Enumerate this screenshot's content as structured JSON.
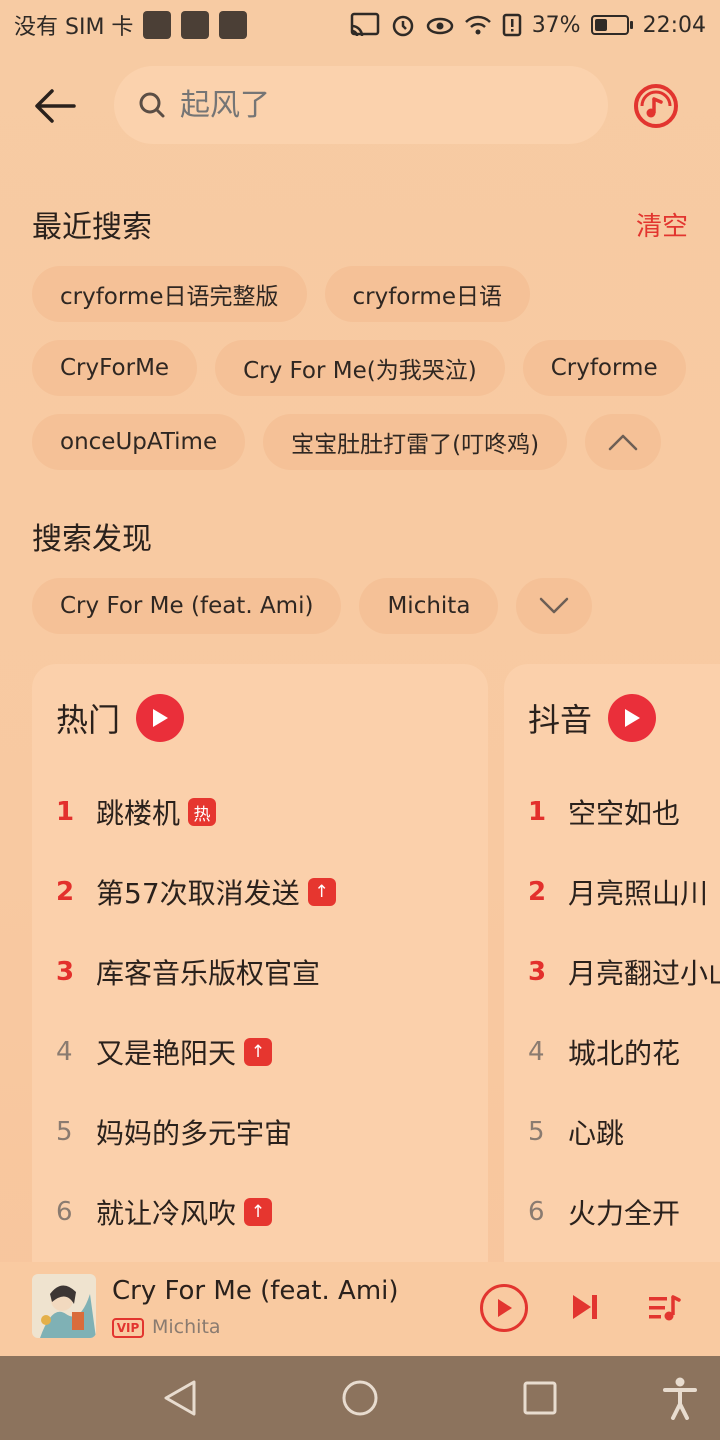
{
  "status_bar": {
    "carrier": "没有 SIM 卡",
    "battery": "37%",
    "time": "22:04"
  },
  "search": {
    "placeholder": "起风了"
  },
  "recent": {
    "title": "最近搜索",
    "clear_label": "清空",
    "chips": [
      [
        "cryforme日语完整版",
        "cryforme日语"
      ],
      [
        "CryForMe",
        "Cry For Me(为我哭泣)",
        "Cryforme"
      ],
      [
        "onceUpATime",
        "宝宝肚肚打雷了(叮咚鸡)"
      ]
    ]
  },
  "discover": {
    "title": "搜索发现",
    "chips": [
      "Cry For Me (feat. Ami)",
      "Michita"
    ]
  },
  "hot_chart": {
    "title": "热门",
    "items": [
      {
        "rank": "1",
        "name": "跳楼机",
        "tag": "热"
      },
      {
        "rank": "2",
        "name": "第57次取消发送",
        "tag": "↑"
      },
      {
        "rank": "3",
        "name": "库客音乐版权官宣",
        "tag": ""
      },
      {
        "rank": "4",
        "name": "又是艳阳天",
        "tag": "↑"
      },
      {
        "rank": "5",
        "name": "妈妈的多元宇宙",
        "tag": ""
      },
      {
        "rank": "6",
        "name": "就让冷风吹",
        "tag": "↑"
      }
    ]
  },
  "douyin_chart": {
    "title": "抖音",
    "items": [
      {
        "rank": "1",
        "name": "空空如也"
      },
      {
        "rank": "2",
        "name": "月亮照山川"
      },
      {
        "rank": "3",
        "name": "月亮翻过小山"
      },
      {
        "rank": "4",
        "name": "城北的花"
      },
      {
        "rank": "5",
        "name": "心跳"
      },
      {
        "rank": "6",
        "name": "火力全开"
      }
    ]
  },
  "player": {
    "title": "Cry For Me (feat. Ami)",
    "vip": "VIP",
    "artist": "Michita"
  },
  "colors": {
    "accent": "#e2352f",
    "background": "#f7c9a0",
    "navbar": "#8c735d"
  }
}
